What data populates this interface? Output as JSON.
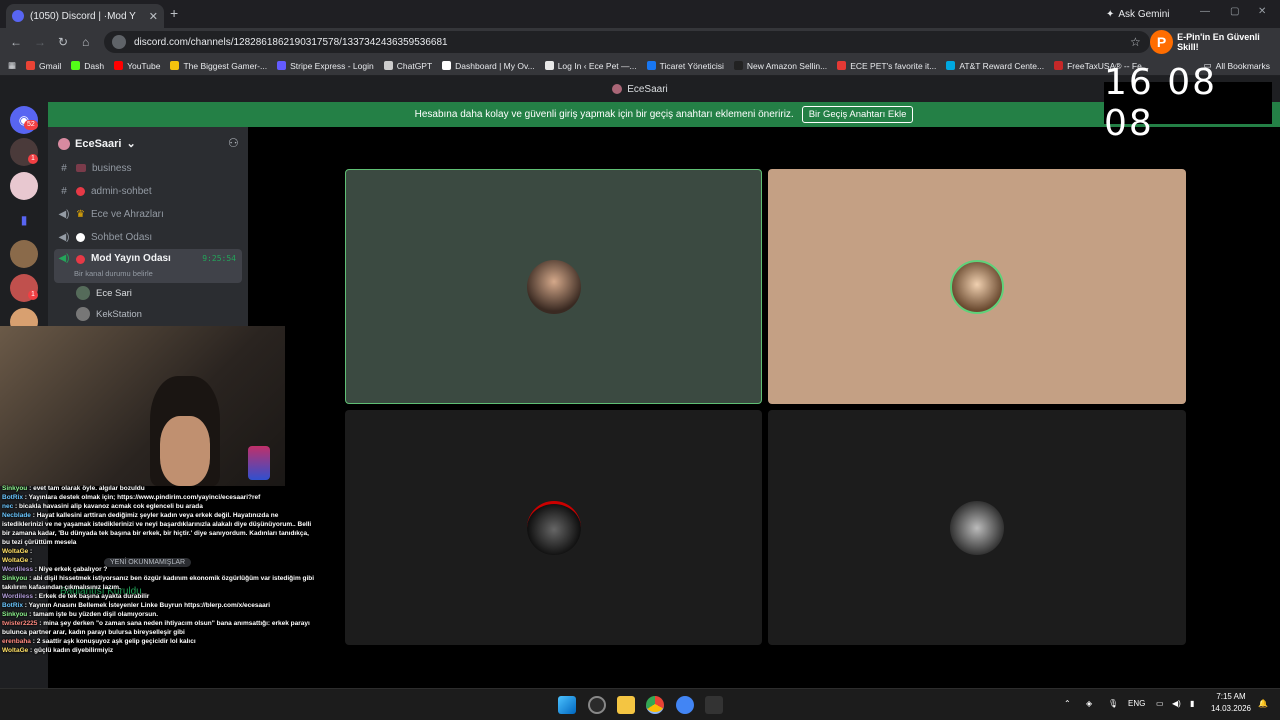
{
  "browser": {
    "tab_title": "(1050) Discord | ·Mod Y",
    "ask_gemini": "Ask Gemini",
    "url": "discord.com/channels/1282861862190317578/1337342436359536681",
    "profile_name": "E-Pin'in En Güvenli Skill!",
    "bookmarks": [
      "Gmail",
      "Dash",
      "YouTube",
      "The Biggest Gamer-...",
      "Stripe Express - Login",
      "ChatGPT",
      "Dashboard | My Ov...",
      "Log In ‹ Ece Pet —...",
      "Ticaret Yöneticisi",
      "New Amazon Sellin...",
      "ECE PET's favorite it...",
      "AT&T Reward Cente...",
      "FreeTaxUSA® -- Fe..."
    ],
    "all_bookmarks": "All Bookmarks"
  },
  "discord": {
    "window_title": "EceSaari",
    "notice_text": "Hesabına daha kolay ve güvenli giriş yapmak için bir geçiş anahtarı eklemeni öneririz.",
    "notice_button": "Bir Geçiş Anahtarı Ekle",
    "inbox_badge": "52",
    "server_name": "EceSaari",
    "channels": [
      {
        "name": "business",
        "type": "text"
      },
      {
        "name": "admin-sohbet",
        "type": "text"
      },
      {
        "name": "Ece ve Ahrazları",
        "type": "voice"
      },
      {
        "name": "Sohbet Odası",
        "type": "voice"
      }
    ],
    "active_channel": {
      "name": "Mod Yayın Odası",
      "time": "9:25:54",
      "status_hint": "Bir kanal durumu belirle"
    },
    "voice_users": [
      "Ece Sari",
      "KekStation"
    ],
    "connection_status": "Bağlantısı Kuruldu",
    "new_unread": "YENİ OKUNMAMIŞLAR"
  },
  "overlay": {
    "clock": "16 08 08"
  },
  "chat": [
    {
      "user": "Sinkyou",
      "text": "evet tam olarak öyle. algılar bozuldu"
    },
    {
      "user": "BotRix",
      "text": "Yayınlara destek olmak için; https://www.pindirim.com/yayinci/ecesaari?ref"
    },
    {
      "user": "nec",
      "text": "bicakla havasini alip kavanoz acmak cok eglenceli bu arada"
    },
    {
      "user": "Necblade",
      "text": "Hayat kallesini arttiran dediğimiz şeyler kadın veya erkek değil. Hayatınızda ne istediklerinizi ve ne yaşamak istediklerinizi ve neyi başardıklarınızla alakalı diye düşünüyorum.. Belli bir zamana kadar, 'Bu dünyada tek başına bir erkek, bir hiçtir.' diye sanıyordum. Kadınları tanıdıkça, bu tezi çürüttüm mesela"
    },
    {
      "user": "WoltaGe",
      "text": ""
    },
    {
      "user": "WoltaGe",
      "text": ""
    },
    {
      "user": "Wordiless",
      "text": "Niye erkek çabalıyor ?"
    },
    {
      "user": "Sinkyou",
      "text": "abi dişil hissetmek istiyorsanız ben özgür kadınım ekonomik özgürlüğüm var istediğim gibi takılırım kafasından çıkmalısınız lazım."
    },
    {
      "user": "Wordiless",
      "text": "Erkek de tek başına ayakta durabilir"
    },
    {
      "user": "BotRix",
      "text": "Yayının Anasını Bellemek İsteyenler Linke Buyrun https://blerp.com/x/ecesaari"
    },
    {
      "user": "Sinkyou",
      "text": "tamam işte bu yüzden dişil olamıyorsun."
    },
    {
      "user": "twister2225",
      "text": "mina şey derken \"o zaman sana neden ihtiyacım olsun\" bana anımsattığı: erkek parayı bulunca partner arar, kadın parayı bulursa bireyselleşir gibi"
    },
    {
      "user": "erenbaha",
      "text": "2 saattir aşk konuşuyoz aşk gelip geçicidir lol kalıcı"
    },
    {
      "user": "WoltaGe",
      "text": "güçlü kadın diyebilirmiyiz"
    }
  ],
  "taskbar": {
    "lang": "ENG",
    "time": "7:15 AM",
    "date": "14.03.2026"
  },
  "colors": {
    "discord_green": "#248046",
    "tile_green": "#3b4a41",
    "tile_tan": "#c4a084",
    "tile_dark": "#1c1c1c"
  }
}
